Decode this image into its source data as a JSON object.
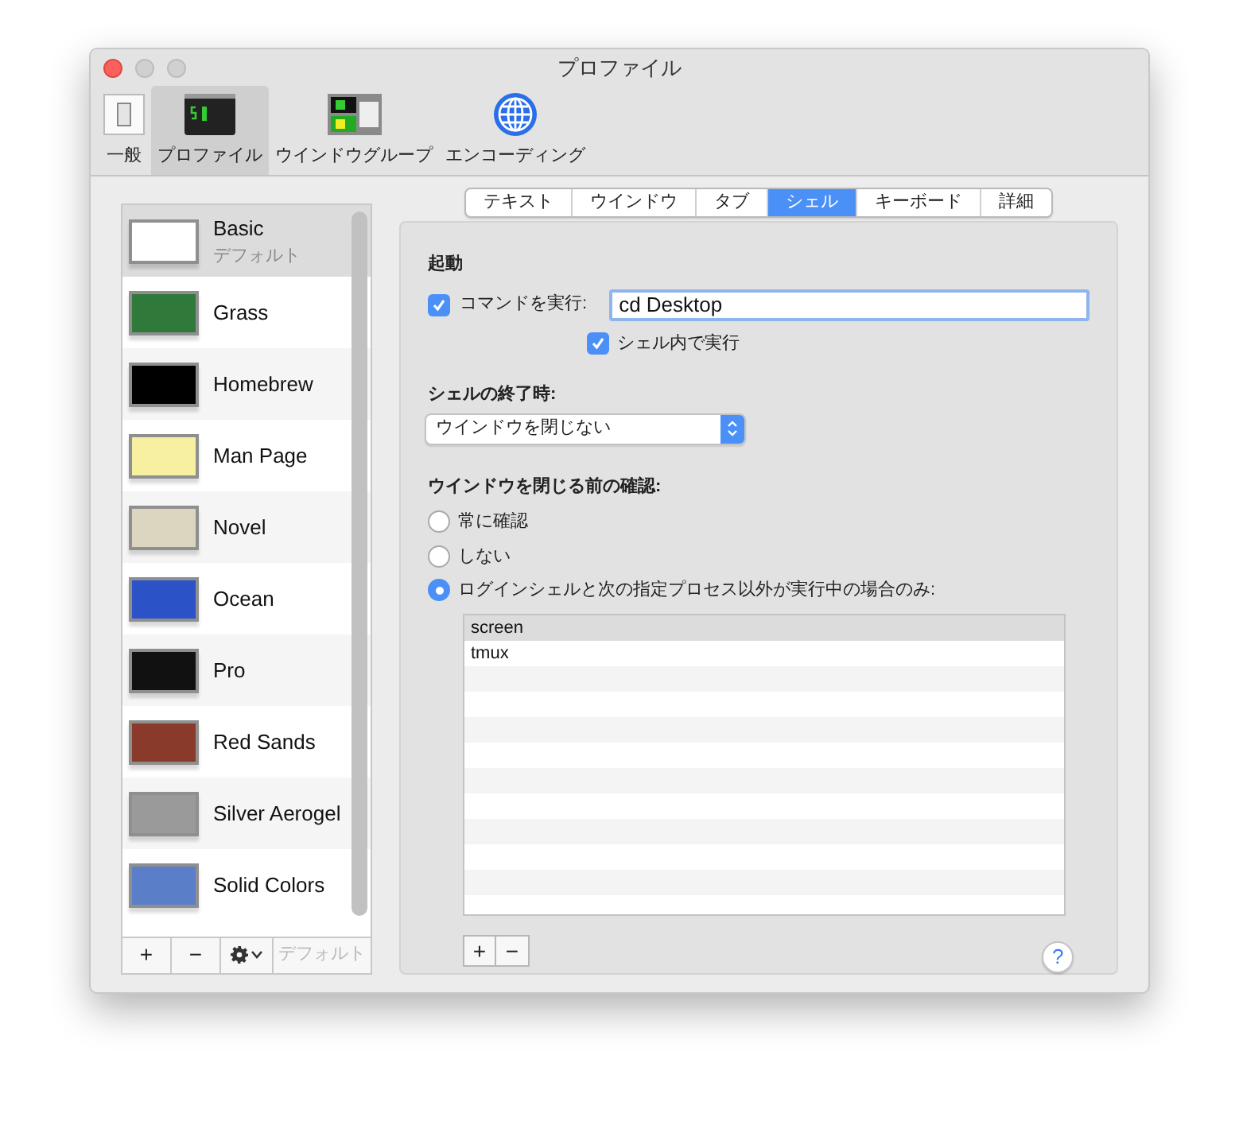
{
  "window": {
    "title": "プロファイル"
  },
  "toolbar": [
    {
      "label": "一般",
      "kind": "switch",
      "selected": false
    },
    {
      "label": "プロファイル",
      "kind": "terminal",
      "selected": true
    },
    {
      "label": "ウインドウグループ",
      "kind": "windows",
      "selected": false
    },
    {
      "label": "エンコーディング",
      "kind": "globe",
      "selected": false
    }
  ],
  "profiles": [
    {
      "name": "Basic",
      "subtitle": "デフォルト",
      "color": "#ffffff",
      "selected": true
    },
    {
      "name": "Grass",
      "color": "#2f7a3a",
      "selected": false
    },
    {
      "name": "Homebrew",
      "color": "#000000",
      "selected": false
    },
    {
      "name": "Man Page",
      "color": "#f6f0a0",
      "selected": false
    },
    {
      "name": "Novel",
      "color": "#dcd6c0",
      "selected": false
    },
    {
      "name": "Ocean",
      "color": "#2c52c8",
      "selected": false
    },
    {
      "name": "Pro",
      "color": "#111111",
      "selected": false
    },
    {
      "name": "Red Sands",
      "color": "#8a3a2a",
      "selected": false
    },
    {
      "name": "Silver Aerogel",
      "color": "#9a9a9a",
      "selected": false
    },
    {
      "name": "Solid Colors",
      "color": "#5a7fc8",
      "selected": false
    }
  ],
  "profile_buttons": {
    "add": "+",
    "remove": "−",
    "default": "デフォルト",
    "default_disabled": true
  },
  "tabs": [
    {
      "label": "テキスト",
      "selected": false
    },
    {
      "label": "ウインドウ",
      "selected": false
    },
    {
      "label": "タブ",
      "selected": false
    },
    {
      "label": "シェル",
      "selected": true
    },
    {
      "label": "キーボード",
      "selected": false
    },
    {
      "label": "詳細",
      "selected": false
    }
  ],
  "startup": {
    "heading": "起動",
    "run_command": {
      "label": "コマンドを実行:",
      "checked": true,
      "value": "cd Desktop"
    },
    "run_in_shell": {
      "label": "シェル内で実行",
      "checked": true
    }
  },
  "on_exit": {
    "heading": "シェルの終了時:",
    "value": "ウインドウを閉じない"
  },
  "confirm": {
    "heading": "ウインドウを閉じる前の確認:",
    "options": [
      {
        "label": "常に確認",
        "selected": false
      },
      {
        "label": "しない",
        "selected": false
      },
      {
        "label": "ログインシェルと次の指定プロセス以外が実行中の場合のみ:",
        "selected": true
      }
    ],
    "processes": [
      {
        "name": "screen",
        "selected": true
      },
      {
        "name": "tmux",
        "selected": false
      }
    ],
    "add": "+",
    "remove": "−"
  },
  "help": "?"
}
